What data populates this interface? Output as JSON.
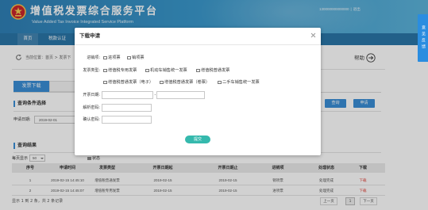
{
  "colors": {
    "accent": "#3a8ed6",
    "header": "#3a98cc",
    "nav": "#2a76a8",
    "submit": "#35b9ad",
    "download_link": "#e0443b",
    "side_tab": "#2a8de0"
  },
  "header": {
    "logo_icon": "national-emblem-icon",
    "title": "增值税发票综合服务平台",
    "subtitle": "Value Added Tax Invoice Integrated Service Platform",
    "user_id": "130000000000000",
    "separator": "|",
    "logout_label": "退出"
  },
  "nav": {
    "items": [
      {
        "label": "首页"
      },
      {
        "label": "税款认证"
      }
    ]
  },
  "breadcrumb": {
    "icon": "refresh-icon",
    "text": "当前位置：首页 > 发票下"
  },
  "help": {
    "label": "帮助",
    "icon": "arrow-right-circle-icon"
  },
  "tabs": [
    {
      "label": "发票下载",
      "active": true
    }
  ],
  "query": {
    "title": "查询条件选择",
    "apply_date_label": "申请日期:",
    "apply_date_value": "2019-02-01",
    "search_label": "查询",
    "apply_label": "申请"
  },
  "results": {
    "title": "查询结果",
    "page_size_label": "每页显示",
    "page_size_value": "50",
    "status_label": "状态",
    "columns": [
      "序号",
      "申请时间",
      "发票类型",
      "开票日期起",
      "开票日期止",
      "进销项",
      "处理状态",
      "下载"
    ],
    "rows": [
      {
        "seq": "1",
        "apply_time": "2019-02-15 14:45:10",
        "invoice_type": "增值税普通发票",
        "date_from": "2019-02-15",
        "date_to": "2019-02-15",
        "direction": "销项票",
        "status": "处理完成",
        "download": "下载"
      },
      {
        "seq": "2",
        "apply_time": "2019-02-15 14:45:07",
        "invoice_type": "增值税专用发票",
        "date_from": "2019-02-15",
        "date_to": "2019-02-15",
        "direction": "进项票",
        "status": "处理完成",
        "download": "下载"
      }
    ],
    "summary": "显示 1 到 2 条，共 2 条记录",
    "pagination": {
      "prev": "上一页",
      "current": "1",
      "next": "下一页"
    }
  },
  "side_tab": {
    "label": "意见反馈"
  },
  "modal": {
    "title": "下载申请",
    "close_icon": "close-icon",
    "direction": {
      "label": "进销项:",
      "options": [
        "进项票",
        "销项票"
      ]
    },
    "invoice_type": {
      "label": "发票类型:",
      "options": [
        "增值税专用发票",
        "机动车销售统一发票",
        "增值税普通发票",
        "增值税普通发票（电子）",
        "增值税普通发票（卷票）",
        "二手车销售统一发票"
      ]
    },
    "invoice_date": {
      "label": "开票日期:",
      "separator": "-"
    },
    "parse_password": {
      "label": "解析密码:"
    },
    "confirm_password": {
      "label": "确认密码:"
    },
    "submit_label": "提交"
  }
}
